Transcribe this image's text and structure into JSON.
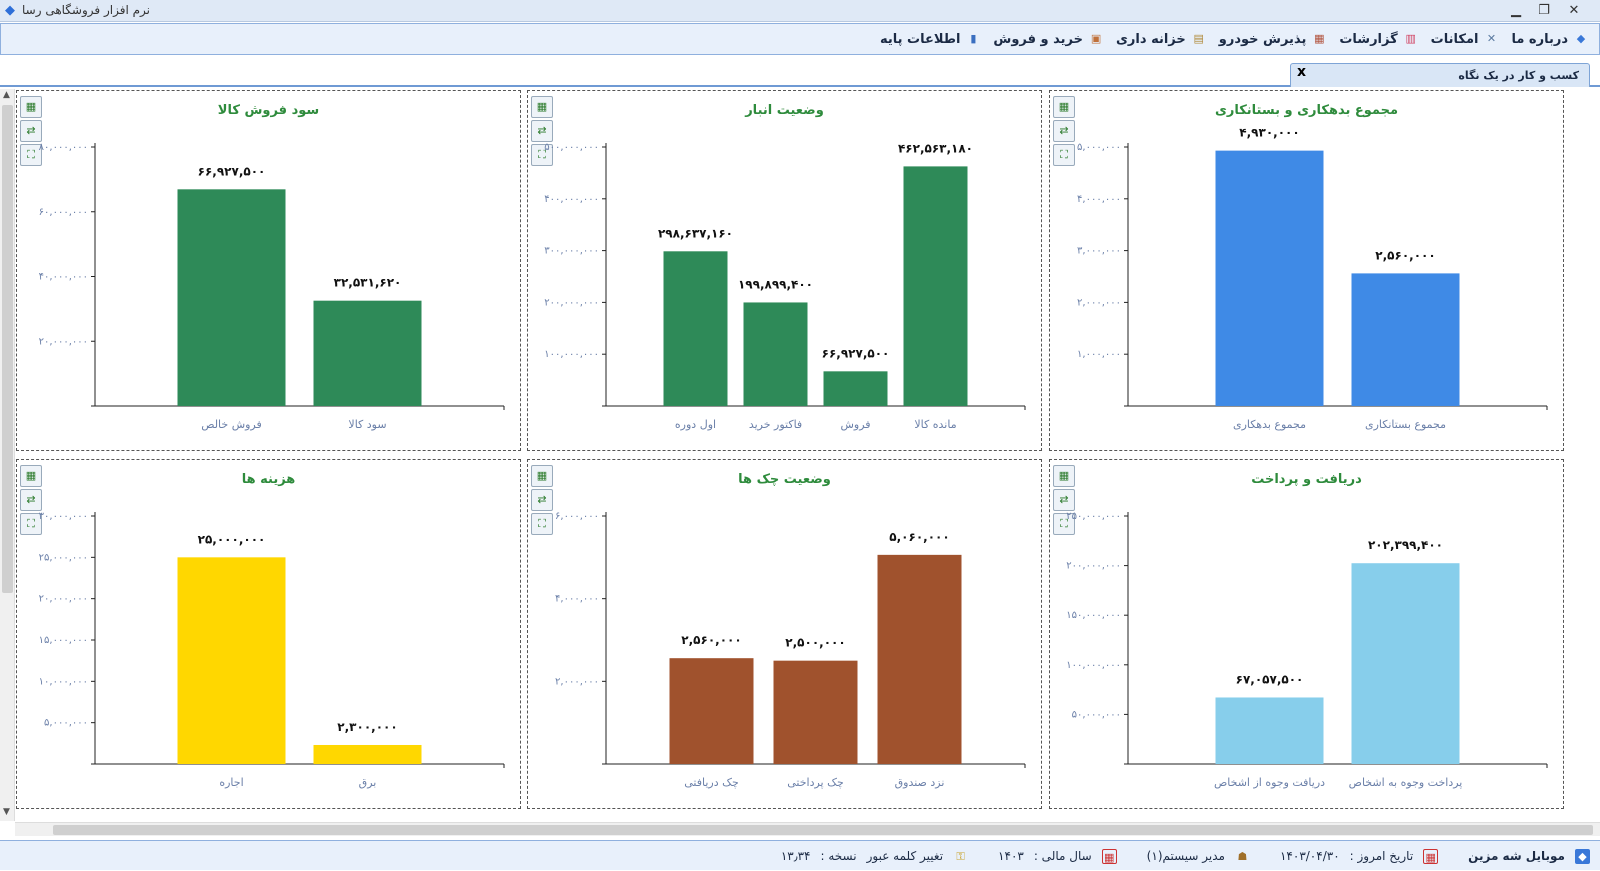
{
  "window": {
    "title": "نرم افزار فروشگاهی رسا",
    "minimize": "▁",
    "restore": "❐",
    "close": "✕"
  },
  "menu": [
    {
      "label": "اطلاعات پایه",
      "icon": "book-icon",
      "glyph": "▮",
      "color": "#3a6fc0"
    },
    {
      "label": "خرید و فروش",
      "icon": "box-icon",
      "glyph": "▣",
      "color": "#c0703a"
    },
    {
      "label": "خزانه داری",
      "icon": "safe-icon",
      "glyph": "▤",
      "color": "#b08a3a"
    },
    {
      "label": "پذیرش خودرو",
      "icon": "car-box-icon",
      "glyph": "▦",
      "color": "#b0503a"
    },
    {
      "label": "گزارشات",
      "icon": "bar-chart-icon",
      "glyph": "▥",
      "color": "#d04060"
    },
    {
      "label": "امکانات",
      "icon": "tools-icon",
      "glyph": "✕",
      "color": "#5a7aa0"
    },
    {
      "label": "درباره ما",
      "icon": "cube-icon",
      "glyph": "◆",
      "color": "#3a78d8"
    }
  ],
  "tab": {
    "label": "کسب و کار در یک نگاه",
    "close": "x"
  },
  "tool_buttons": [
    "excel-export-icon",
    "refresh-icon",
    "expand-icon"
  ],
  "tool_glyphs": [
    "▦",
    "⇄",
    "⛶"
  ],
  "chart_data": [
    {
      "type": "bar",
      "title": "مجموع بدهکاری و بستانکاری",
      "categories": [
        "مجموع بدهکاری",
        "مجموع بستانکاری"
      ],
      "values": [
        4930000,
        2560000
      ],
      "labels": [
        "۴,۹۳۰,۰۰۰",
        "۲,۵۶۰,۰۰۰"
      ],
      "ylim": [
        0,
        5000000
      ],
      "yticks": [
        1000000,
        2000000,
        3000000,
        4000000,
        5000000
      ],
      "ytick_labels": [
        "۱,۰۰۰,۰۰۰",
        "۲,۰۰۰,۰۰۰",
        "۳,۰۰۰,۰۰۰",
        "۴,۰۰۰,۰۰۰",
        "۵,۰۰۰,۰۰۰"
      ],
      "color": "#3f8ae6"
    },
    {
      "type": "bar",
      "title": "وضعیت انبار",
      "categories": [
        "اول دوره",
        "فاکتور خرید",
        "فروش",
        "مانده کالا"
      ],
      "values": [
        298637160,
        199899400,
        66927500,
        462563180
      ],
      "labels": [
        "۲۹۸,۶۳۷,۱۶۰",
        "۱۹۹,۸۹۹,۴۰۰",
        "۶۶,۹۲۷,۵۰۰",
        "۴۶۲,۵۶۳,۱۸۰"
      ],
      "ylim": [
        0,
        500000000
      ],
      "yticks": [
        100000000,
        200000000,
        300000000,
        400000000,
        500000000
      ],
      "ytick_labels": [
        "۱۰۰,۰۰۰,۰۰۰",
        "۲۰۰,۰۰۰,۰۰۰",
        "۳۰۰,۰۰۰,۰۰۰",
        "۴۰۰,۰۰۰,۰۰۰",
        "۵۰۰,۰۰۰,۰۰۰"
      ],
      "color": "#2e8a58"
    },
    {
      "type": "bar",
      "title": "سود فروش کالا",
      "categories": [
        "فروش خالص",
        "سود کالا"
      ],
      "values": [
        66927500,
        32531620
      ],
      "labels": [
        "۶۶,۹۲۷,۵۰۰",
        "۳۲,۵۳۱,۶۲۰"
      ],
      "ylim": [
        0,
        80000000
      ],
      "yticks": [
        20000000,
        40000000,
        60000000,
        80000000
      ],
      "ytick_labels": [
        "۲۰,۰۰۰,۰۰۰",
        "۴۰,۰۰۰,۰۰۰",
        "۶۰,۰۰۰,۰۰۰",
        "۸۰,۰۰۰,۰۰۰"
      ],
      "color": "#2e8a58"
    },
    {
      "type": "bar",
      "title": "دریافت و پرداخت",
      "categories": [
        "دریافت وجوه از اشخاص",
        "پرداخت وجوه به اشخاص"
      ],
      "values": [
        67057500,
        202399400
      ],
      "labels": [
        "۶۷,۰۵۷,۵۰۰",
        "۲۰۲,۳۹۹,۴۰۰"
      ],
      "ylim": [
        0,
        250000000
      ],
      "yticks": [
        50000000,
        100000000,
        150000000,
        200000000,
        250000000
      ],
      "ytick_labels": [
        "۵۰,۰۰۰,۰۰۰",
        "۱۰۰,۰۰۰,۰۰۰",
        "۱۵۰,۰۰۰,۰۰۰",
        "۲۰۰,۰۰۰,۰۰۰",
        "۲۵۰,۰۰۰,۰۰۰"
      ],
      "color": "#87ceeb"
    },
    {
      "type": "bar",
      "title": "وضعیت چک ها",
      "categories": [
        "چک دریافتی",
        "چک پرداختی",
        "نزد صندوق"
      ],
      "values": [
        2560000,
        2500000,
        5060000
      ],
      "labels": [
        "۲,۵۶۰,۰۰۰",
        "۲,۵۰۰,۰۰۰",
        "۵,۰۶۰,۰۰۰"
      ],
      "ylim": [
        0,
        6000000
      ],
      "yticks": [
        2000000,
        4000000,
        6000000
      ],
      "ytick_labels": [
        "۲,۰۰۰,۰۰۰",
        "۴,۰۰۰,۰۰۰",
        "۶,۰۰۰,۰۰۰"
      ],
      "color": "#a0522d"
    },
    {
      "type": "bar",
      "title": "هزینه ها",
      "categories": [
        "اجاره",
        "برق"
      ],
      "values": [
        25000000,
        2300000
      ],
      "labels": [
        "۲۵,۰۰۰,۰۰۰",
        "۲,۳۰۰,۰۰۰"
      ],
      "ylim": [
        0,
        30000000
      ],
      "yticks": [
        5000000,
        10000000,
        15000000,
        20000000,
        25000000,
        30000000
      ],
      "ytick_labels": [
        "۵,۰۰۰,۰۰۰",
        "۱۰,۰۰۰,۰۰۰",
        "۱۵,۰۰۰,۰۰۰",
        "۲۰,۰۰۰,۰۰۰",
        "۲۵,۰۰۰,۰۰۰",
        "۳۰,۰۰۰,۰۰۰"
      ],
      "color": "#ffd700"
    }
  ],
  "status": {
    "company": "موبایل شه مزین",
    "date_label": "تاریخ امروز :",
    "date_value": "۱۴۰۳/۰۴/۳۰",
    "user": "مدیر سیستم(۱)",
    "fiscal_label": "سال مالی :",
    "fiscal_value": "۱۴۰۳",
    "change_password": "تغییر کلمه عبور",
    "version_label": "نسخه :",
    "version_value": "۱۳٫۳۴"
  }
}
